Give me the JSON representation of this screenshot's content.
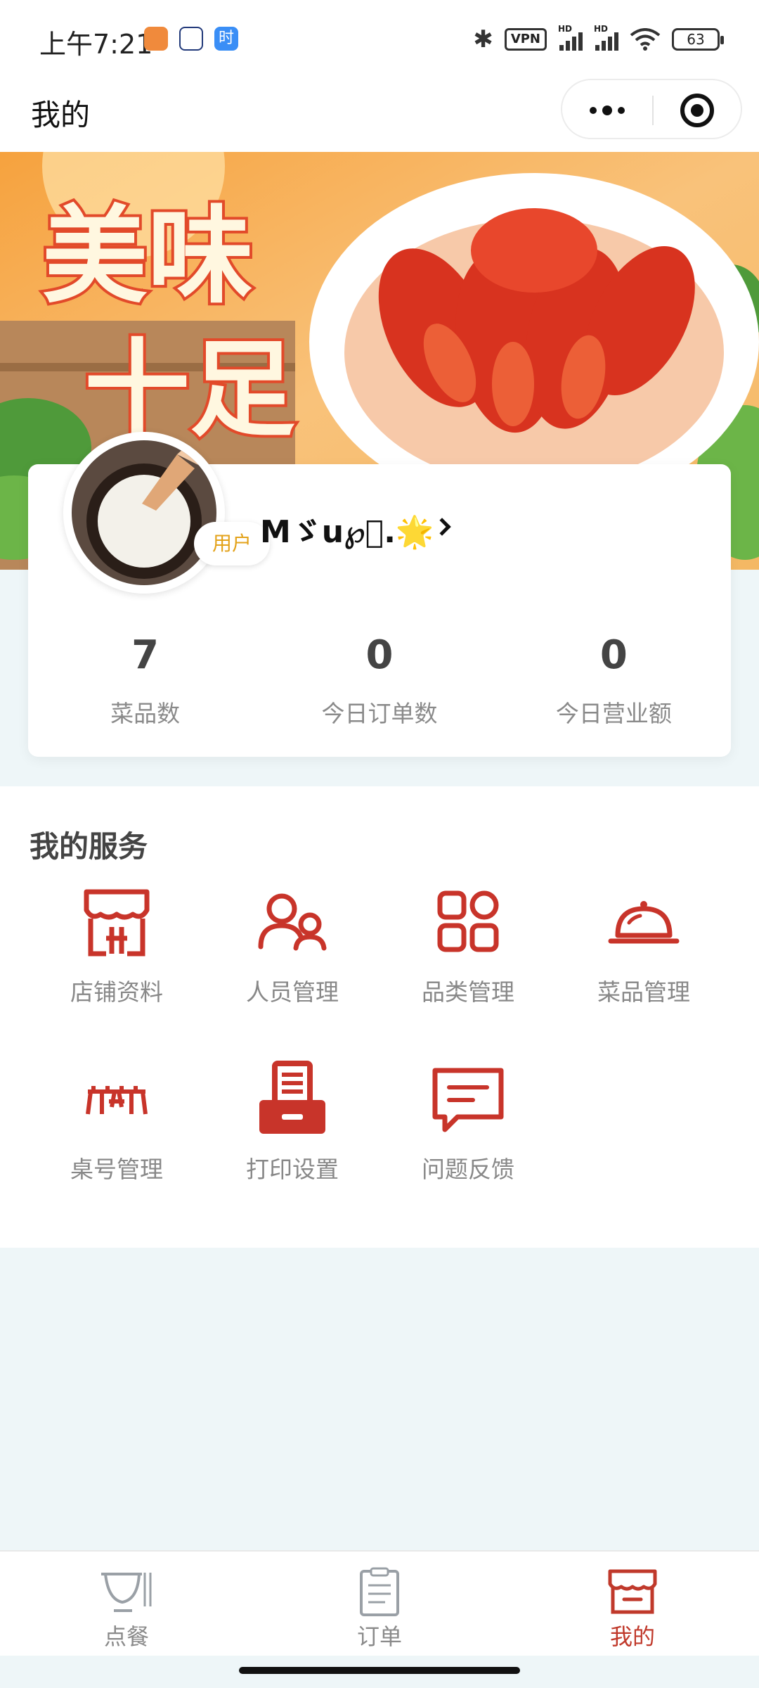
{
  "status_bar": {
    "time": "上午7:21",
    "app_icons": [
      "health-icon",
      "cat-icon",
      "time-app-icon"
    ],
    "time_app_glyph": "时",
    "vpn": "VPN",
    "signal_label": "HD",
    "battery": "63"
  },
  "nav": {
    "title": "我的"
  },
  "profile": {
    "user_name": "Mゞu℘ͦ.🌟",
    "role": "用户",
    "stats": [
      {
        "value": "7",
        "label": "菜品数"
      },
      {
        "value": "0",
        "label": "今日订单数"
      },
      {
        "value": "0",
        "label": "今日营业额"
      }
    ]
  },
  "banner": {
    "headline": "美味十足"
  },
  "services": {
    "title": "我的服务",
    "items": [
      {
        "label": "店铺资料",
        "icon": "shop-icon"
      },
      {
        "label": "人员管理",
        "icon": "users-icon"
      },
      {
        "label": "品类管理",
        "icon": "category-grid-icon"
      },
      {
        "label": "菜品管理",
        "icon": "dish-cloche-icon"
      },
      {
        "label": "桌号管理",
        "icon": "table-icon"
      },
      {
        "label": "打印设置",
        "icon": "printer-icon"
      },
      {
        "label": "问题反馈",
        "icon": "feedback-icon"
      }
    ]
  },
  "tabbar": {
    "items": [
      {
        "label": "点餐",
        "icon": "order-food-icon"
      },
      {
        "label": "订单",
        "icon": "orders-clipboard-icon"
      },
      {
        "label": "我的",
        "icon": "mine-shop-icon"
      }
    ],
    "active_index": 2
  },
  "colors": {
    "accent": "#c0392b",
    "role_badge": "#e3a21a",
    "page_bg": "#eef6f8"
  }
}
